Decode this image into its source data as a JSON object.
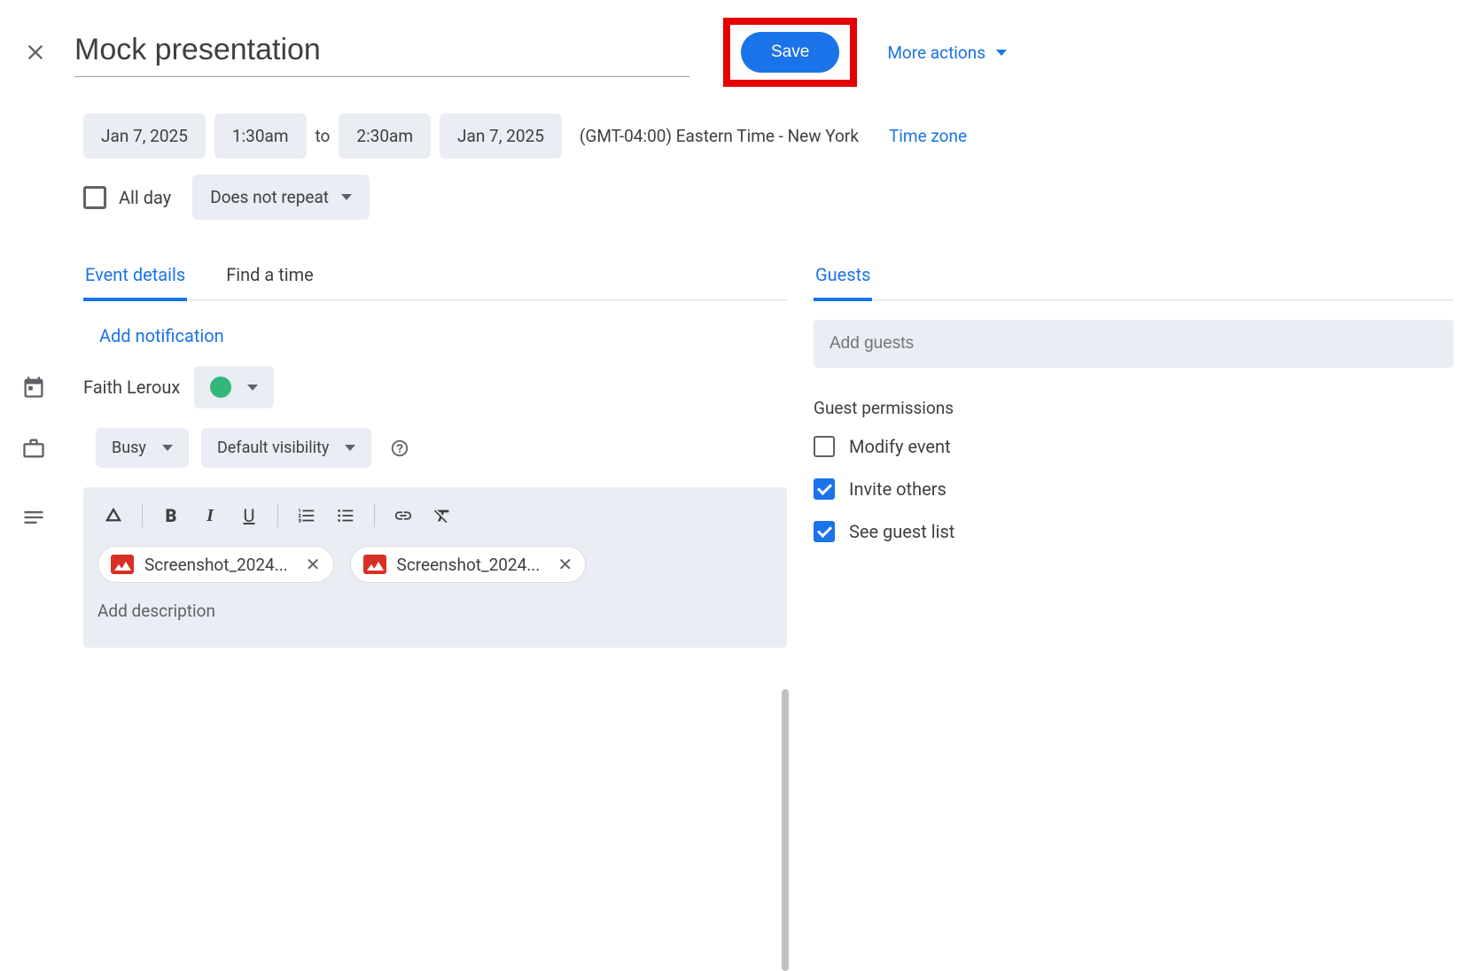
{
  "header": {
    "title": "Mock presentation",
    "save_label": "Save",
    "more_actions_label": "More actions"
  },
  "datetime": {
    "start_date": "Jan 7, 2025",
    "start_time": "1:30am",
    "to": "to",
    "end_time": "2:30am",
    "end_date": "Jan 7, 2025",
    "tz_text": "(GMT-04:00) Eastern Time - New York",
    "tz_link": "Time zone"
  },
  "options": {
    "all_day_label": "All day",
    "repeat_label": "Does not repeat"
  },
  "tabs": {
    "details": "Event details",
    "find_time": "Find a time",
    "guests": "Guests"
  },
  "details": {
    "add_notification": "Add notification",
    "organizer": "Faith Leroux",
    "availability": "Busy",
    "visibility": "Default visibility",
    "attachments": [
      {
        "name": "Screenshot_2024..."
      },
      {
        "name": "Screenshot_2024..."
      }
    ],
    "desc_placeholder": "Add description"
  },
  "guests": {
    "placeholder": "Add guests",
    "permissions_title": "Guest permissions",
    "modify_label": "Modify event",
    "invite_label": "Invite others",
    "see_list_label": "See guest list",
    "modify_checked": false,
    "invite_checked": true,
    "see_list_checked": true
  }
}
